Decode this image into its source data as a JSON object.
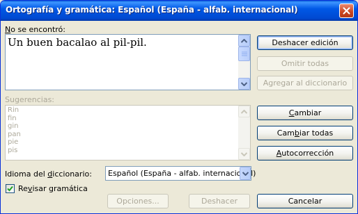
{
  "window": {
    "title": "Ortografía y gramática: Español (España - alfab. internacional)"
  },
  "not_found": {
    "label_accel": "N",
    "label_rest": "o se encontró:",
    "text": "Un buen bacalao al pil-pil."
  },
  "suggestions": {
    "label": "Sugerencias:",
    "items": [
      "Rin",
      "fin",
      "gin",
      "pan",
      "pie",
      "pis"
    ]
  },
  "buttons": {
    "undo_edit": "Deshacer edición",
    "ignore_all": "Omitir todas",
    "add_to_dictionary": "Agregar al diccionario",
    "change_accel": "C",
    "change_rest": "ambiar",
    "change_all_pre": "Cam",
    "change_all_accel": "b",
    "change_all_rest": "iar todas",
    "autocorrect_accel": "A",
    "autocorrect_rest": "utocorrección",
    "options": "Opciones...",
    "undo": "Deshacer",
    "cancel": "Cancelar"
  },
  "dictionary_language": {
    "label_pre": "Idioma del ",
    "label_accel": "d",
    "label_rest": "iccionario:",
    "selected": "Español (España - alfab. internacional)"
  },
  "check_grammar": {
    "checked": true,
    "label_pre": "Re",
    "label_accel": "v",
    "label_rest": "isar gramática"
  },
  "colors": {
    "titlebar": "#0058e6",
    "dialog_bg": "#ece9d8",
    "disabled_text": "#aca899",
    "close_button": "#c94420"
  }
}
